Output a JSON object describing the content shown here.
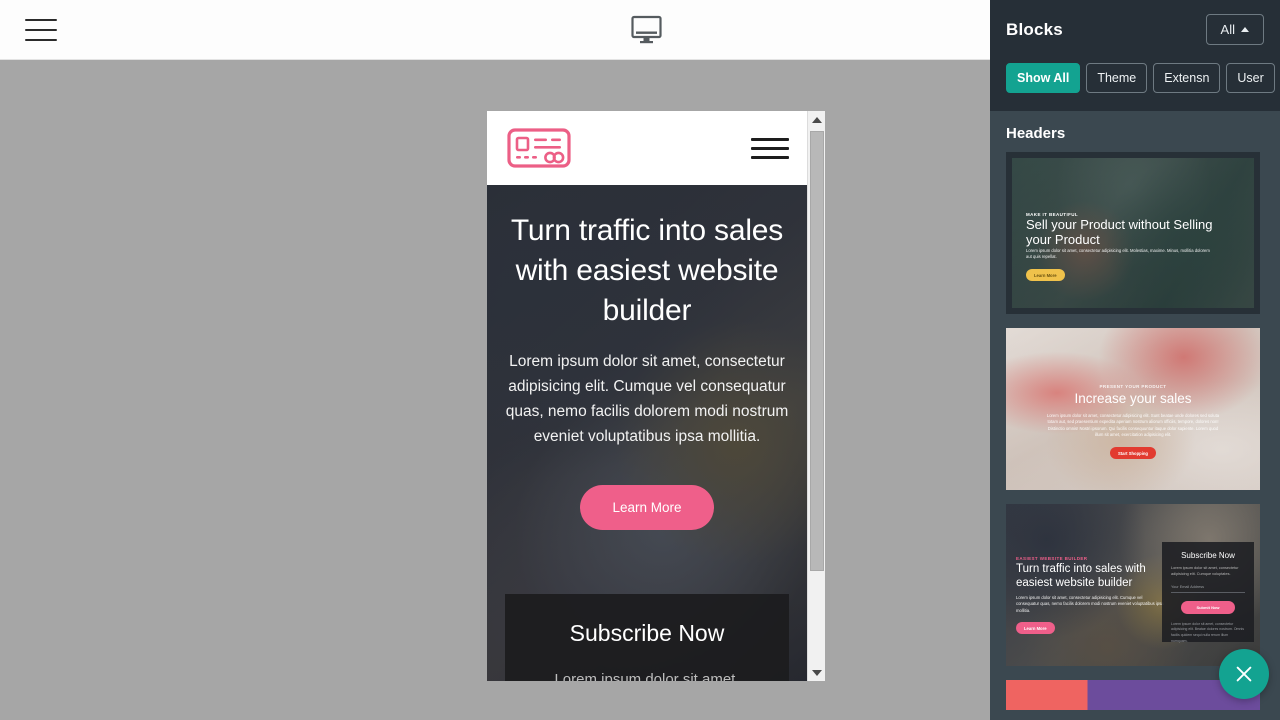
{
  "topbar": {
    "menu_icon": "hamburger-icon",
    "device_icon": "desktop-monitor-icon"
  },
  "preview": {
    "site": {
      "logo_icon": "card-logo-icon",
      "menu_icon": "hamburger-icon",
      "hero": {
        "heading": "Turn traffic into sales with easiest website builder",
        "paragraph": "Lorem ipsum dolor sit amet, consectetur adipisicing elit. Cumque vel consequatur quas, nemo facilis dolorem modi nostrum eveniet voluptatibus ipsa mollitia.",
        "button": "Learn More"
      },
      "subscribe": {
        "heading": "Subscribe Now",
        "paragraph": "Lorem ipsum dolor sit amet,"
      }
    },
    "scrollbar": {
      "up_icon": "scroll-up-arrow-icon",
      "down_icon": "scroll-down-arrow-icon"
    }
  },
  "sidebar": {
    "title": "Blocks",
    "all_dropdown": {
      "label": "All",
      "caret_icon": "caret-up-icon"
    },
    "filters": [
      {
        "label": "Show All",
        "active": true
      },
      {
        "label": "Theme",
        "active": false
      },
      {
        "label": "Extensn",
        "active": false
      },
      {
        "label": "User",
        "active": false
      }
    ],
    "section_title": "Headers",
    "blocks": [
      {
        "name": "sell-your-product-header",
        "eyebrow": "Make it Beautiful",
        "heading": "Sell your Product without Selling your Product",
        "paragraph": "Lorem ipsum dolor sit amet, consectetur adipisicing elit. Molestias, maxime. Minus, mollitia dolorem aut quis repellat.",
        "button": "Learn More"
      },
      {
        "name": "increase-your-sales-header",
        "eyebrow": "Present Your Product",
        "heading": "Increase your sales",
        "paragraph": "Lorem ipsum dolor sit amet, consectetur adipisicing elit. Sunt beatae unde dolores sed soluta totam aut, sed praesentium expedita aperiam nostrum aliorum officiis, tempore, dolores non! Distinctio omnis! Nostri ipsorum. Qui facilis consequuntur itaque dolor sapiente. Lorem quod illum sit amet, exercitation adipisicing elit.",
        "button": "Start Shopping"
      },
      {
        "name": "turn-traffic-header",
        "eyebrow": "Easiest Website Builder",
        "heading": "Turn traffic into sales with easiest website builder",
        "paragraph": "Lorem ipsum dolor sit amet, consectetur adipisicing elit. Cumque vel consequatur quas, nemo facilis dolorem modi nostrum eveniet voluptatibus ipsa mollitia.",
        "button": "Learn More",
        "subscribe": {
          "heading": "Subscribe Now",
          "paragraph": "Lorem ipsum dolor sit amet, consectetur adipisicing elit. Cumque voluptates.",
          "field_placeholder": "Your Email Address",
          "button": "Submit Now",
          "note": "Lorem ipsum dolor sit amet, consectetur adipisicing elit. Beatae dolores nostrum. Omnis facilis quidem sequi nulla rerum illum numquam."
        }
      }
    ]
  },
  "close_button": {
    "icon": "close-x-icon"
  },
  "colors": {
    "accent_pink": "#ef5f8a",
    "accent_teal": "#13a391",
    "sidebar_dark": "#262f37",
    "sidebar_body": "#3b4850",
    "workspace_bg": "#a6a6a6"
  }
}
